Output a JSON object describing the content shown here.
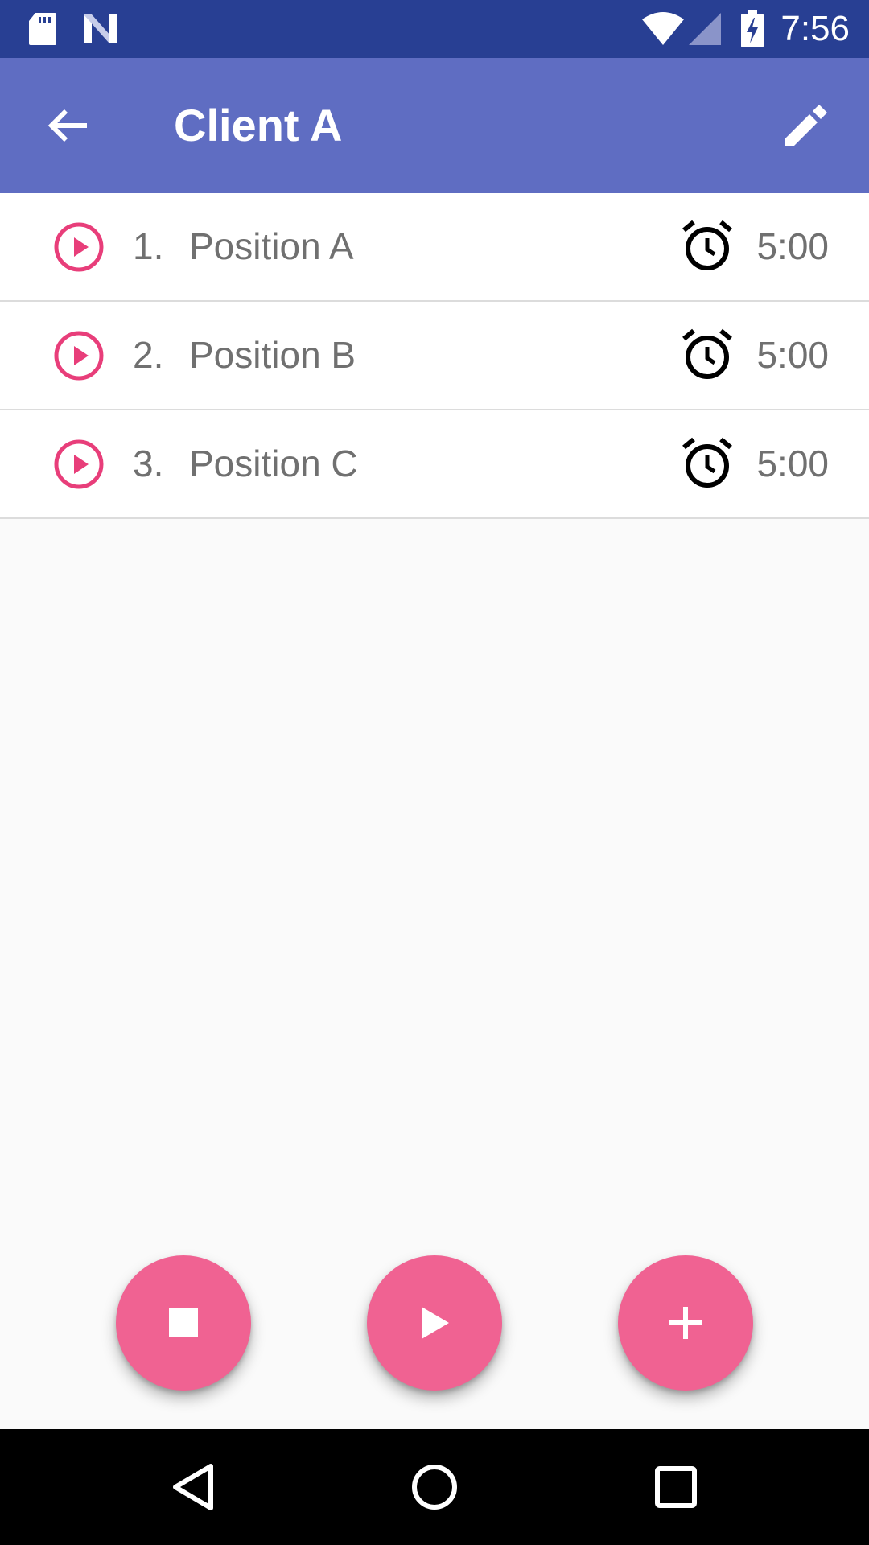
{
  "status_bar": {
    "time": "7:56",
    "icons": [
      "sd-card-icon",
      "n-logo-icon",
      "wifi-icon",
      "cell-signal-icon",
      "battery-charging-icon"
    ]
  },
  "app_bar": {
    "title": "Client A",
    "back_icon": "arrow-back-icon",
    "edit_icon": "pencil-icon"
  },
  "positions": [
    {
      "number": "1.",
      "name": "Position A",
      "duration": "5:00"
    },
    {
      "number": "2.",
      "name": "Position B",
      "duration": "5:00"
    },
    {
      "number": "3.",
      "name": "Position C",
      "duration": "5:00"
    }
  ],
  "fabs": [
    {
      "icon": "stop-icon"
    },
    {
      "icon": "play-icon"
    },
    {
      "icon": "plus-icon"
    }
  ],
  "nav_bar": {
    "icons": [
      "nav-back-icon",
      "nav-home-icon",
      "nav-recents-icon"
    ]
  },
  "colors": {
    "status_bar": "#283f93",
    "app_bar": "#5f6dc2",
    "accent": "#e83e7a",
    "fab": "#f06292",
    "list_text": "#707070",
    "divider": "#dcdcdc"
  }
}
